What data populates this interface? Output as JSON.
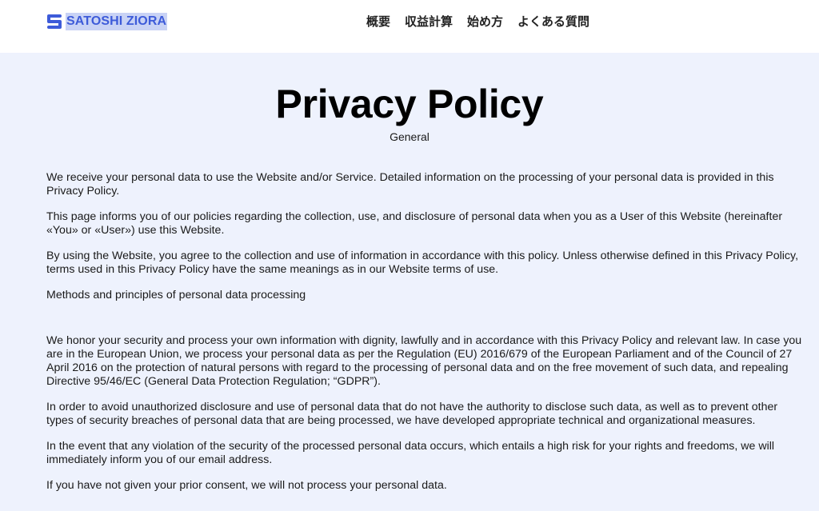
{
  "header": {
    "logo_text": "SATOSHI ZIORA",
    "logo_icon": "s-logo-icon",
    "brand_color": "#3d5bd9",
    "logo_highlight": "#c9d3f5",
    "nav": [
      {
        "label": "概要"
      },
      {
        "label": "収益計算"
      },
      {
        "label": "始め方"
      },
      {
        "label": "よくある質問"
      }
    ]
  },
  "main": {
    "background": "#eef2fd",
    "title": "Privacy Policy",
    "subtitle": "General",
    "paragraphs": [
      "We receive your personal data to use the Website and/or Service. Detailed information on the processing of your personal data is provided in this Privacy Policy.",
      "This page informs you of our policies regarding the collection, use, and disclosure of personal data when you as a User of this Website (hereinafter «You» or «User») use this Website.",
      "By using the Website, you agree to the collection and use of information in accordance with this policy. Unless otherwise defined in this Privacy Policy, terms used in this Privacy Policy have the same meanings as in our Website terms of use.",
      "Methods and principles of personal data processing",
      "We honor your security and process your own information with dignity, lawfully and in accordance with this Privacy Policy and relevant law. In case you are in the European Union, we process your personal data as per the Regulation (EU) 2016/679 of the European Parliament and of the Council of 27 April 2016 on the protection of natural persons with regard to the processing of personal data and on the free movement of such data, and repealing Directive 95/46/EC (General Data Protection Regulation; “GDPR”).",
      "In order to avoid unauthorized disclosure and use of personal data that do not have the authority to disclose such data, as well as to prevent other types of security breaches of personal data that are being processed, we have developed appropriate technical and organizational measures.",
      "In the event that any violation of the security of the processed personal data occurs, which entails a high risk for your rights and freedoms, we will immediately inform you of our email address.",
      "If you have not given your prior consent, we will not process your personal data."
    ]
  }
}
